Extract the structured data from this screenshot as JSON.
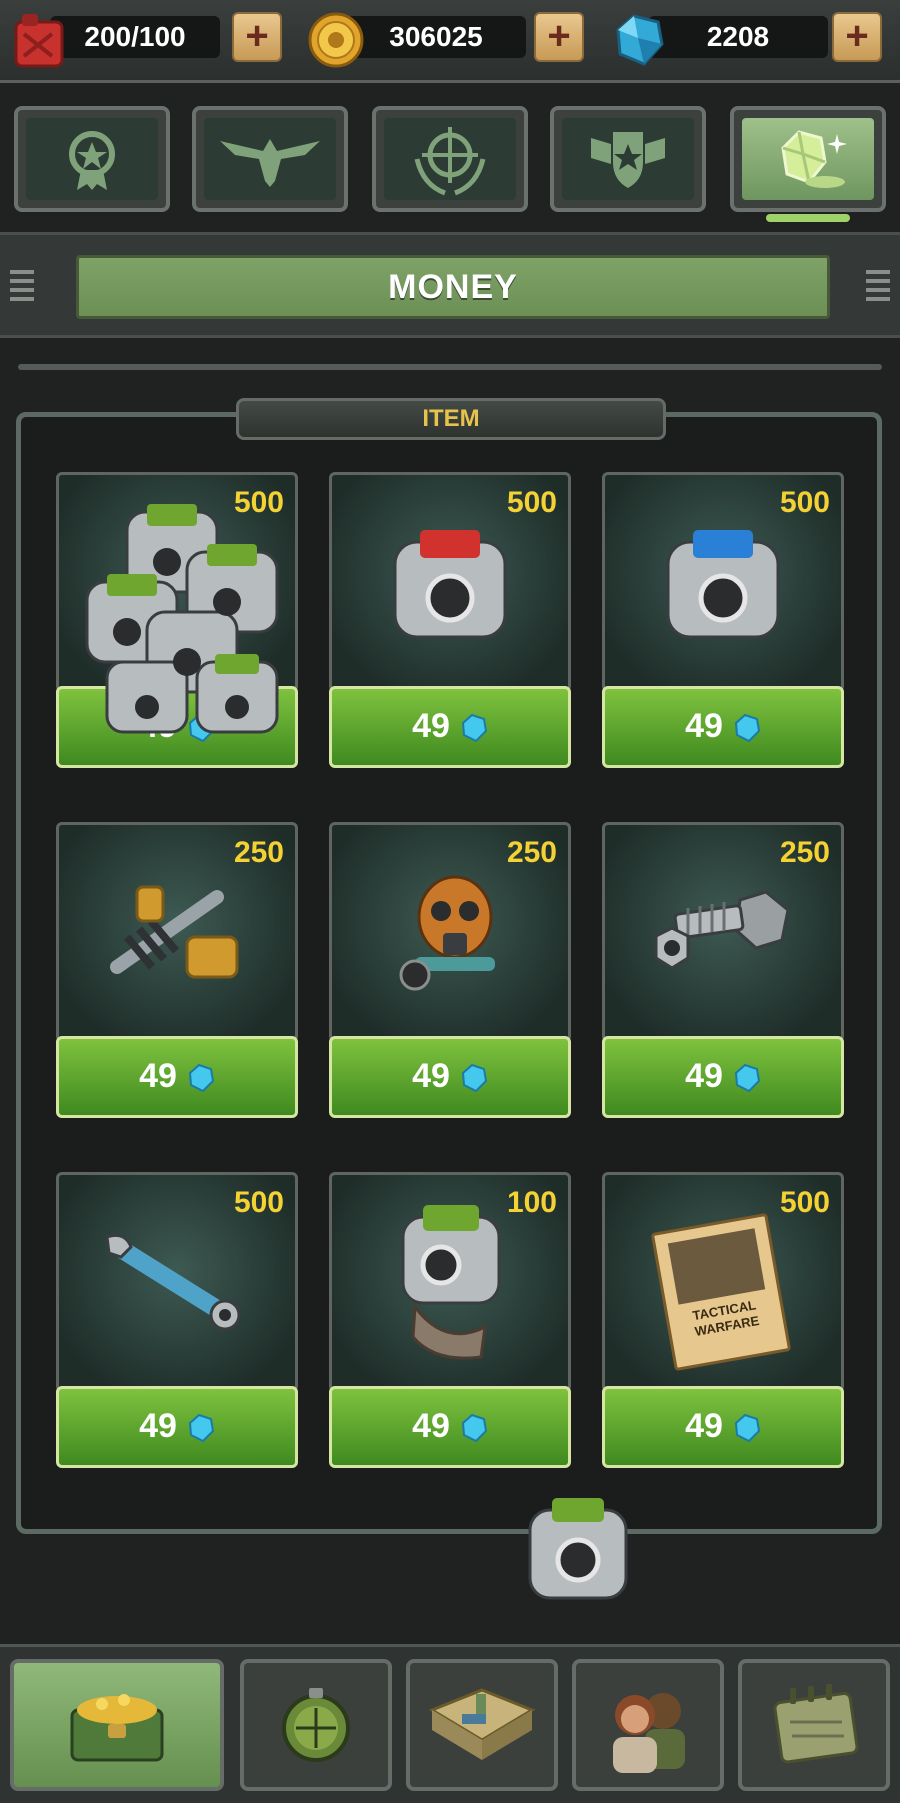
{
  "resources": {
    "fuel": {
      "value": "200/100",
      "icon": "fuel-can-icon"
    },
    "coins": {
      "value": "306025",
      "icon": "gold-coin-icon"
    },
    "gems": {
      "value": "2208",
      "icon": "blue-gem-icon"
    },
    "plus_label": "+"
  },
  "tabs": [
    {
      "icon": "medal-star-icon",
      "active": false
    },
    {
      "icon": "eagle-wings-icon",
      "active": false
    },
    {
      "icon": "crosshair-laurel-icon",
      "active": false
    },
    {
      "icon": "shield-star-icon",
      "active": false
    },
    {
      "icon": "gem-stone-icon",
      "active": true
    }
  ],
  "section_title": "MONEY",
  "panel_title": "ITEM",
  "items": [
    {
      "qty": "500",
      "price": "49",
      "icon": "green-gear-pile-icon"
    },
    {
      "qty": "500",
      "price": "49",
      "icon": "red-gear-icon"
    },
    {
      "qty": "500",
      "price": "49",
      "icon": "blue-gear-icon"
    },
    {
      "qty": "250",
      "price": "49",
      "icon": "spring-spike-icon"
    },
    {
      "qty": "250",
      "price": "49",
      "icon": "gas-mask-icon"
    },
    {
      "qty": "250",
      "price": "49",
      "icon": "bolt-nut-icon"
    },
    {
      "qty": "500",
      "price": "49",
      "icon": "wrench-icon"
    },
    {
      "qty": "100",
      "price": "49",
      "icon": "green-gear-icon"
    },
    {
      "qty": "500",
      "price": "49",
      "icon": "tactical-warfare-manual-icon"
    }
  ],
  "manual_text": "TACTICAL WARFARE",
  "bottom_nav": [
    {
      "icon": "treasure-chest-icon",
      "active": true
    },
    {
      "icon": "compass-icon",
      "active": false
    },
    {
      "icon": "map-icon",
      "active": false
    },
    {
      "icon": "soldiers-icon",
      "active": false
    },
    {
      "icon": "calendar-icon",
      "active": false
    }
  ],
  "colors": {
    "accent_green": "#5fa52c",
    "qty_yellow": "#f4d234",
    "gem_blue": "#3fc3e8"
  }
}
